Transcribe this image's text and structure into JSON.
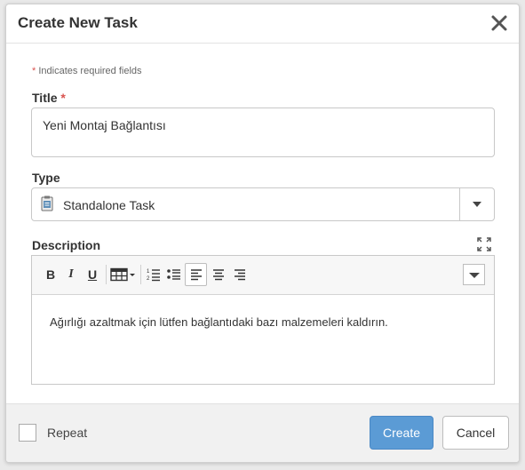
{
  "dialog": {
    "title": "Create New Task",
    "close_icon": "close-icon"
  },
  "form": {
    "required_star": "*",
    "required_note": "Indicates required fields",
    "title_label": "Title",
    "title_value": "Yeni Montaj Bağlantısı",
    "type_label": "Type",
    "type_value": "Standalone Task",
    "type_icon": "task-clipboard-icon",
    "description_label": "Description",
    "description_text": "Ağırlığı azaltmak için lütfen bağlantıdaki bazı malzemeleri kaldırın."
  },
  "editor_toolbar": {
    "bold": "B",
    "italic": "I",
    "underline": "U",
    "icons": [
      "table-icon",
      "numbered-list-icon",
      "bullet-list-icon",
      "align-left-icon",
      "align-center-icon",
      "align-right-icon",
      "chevron-down-icon"
    ],
    "active_item": "align-left"
  },
  "footer": {
    "repeat_label": "Repeat",
    "repeat_checked": false,
    "create_label": "Create",
    "cancel_label": "Cancel"
  },
  "colors": {
    "accent": "#5b9bd5",
    "required": "#d9534f"
  }
}
